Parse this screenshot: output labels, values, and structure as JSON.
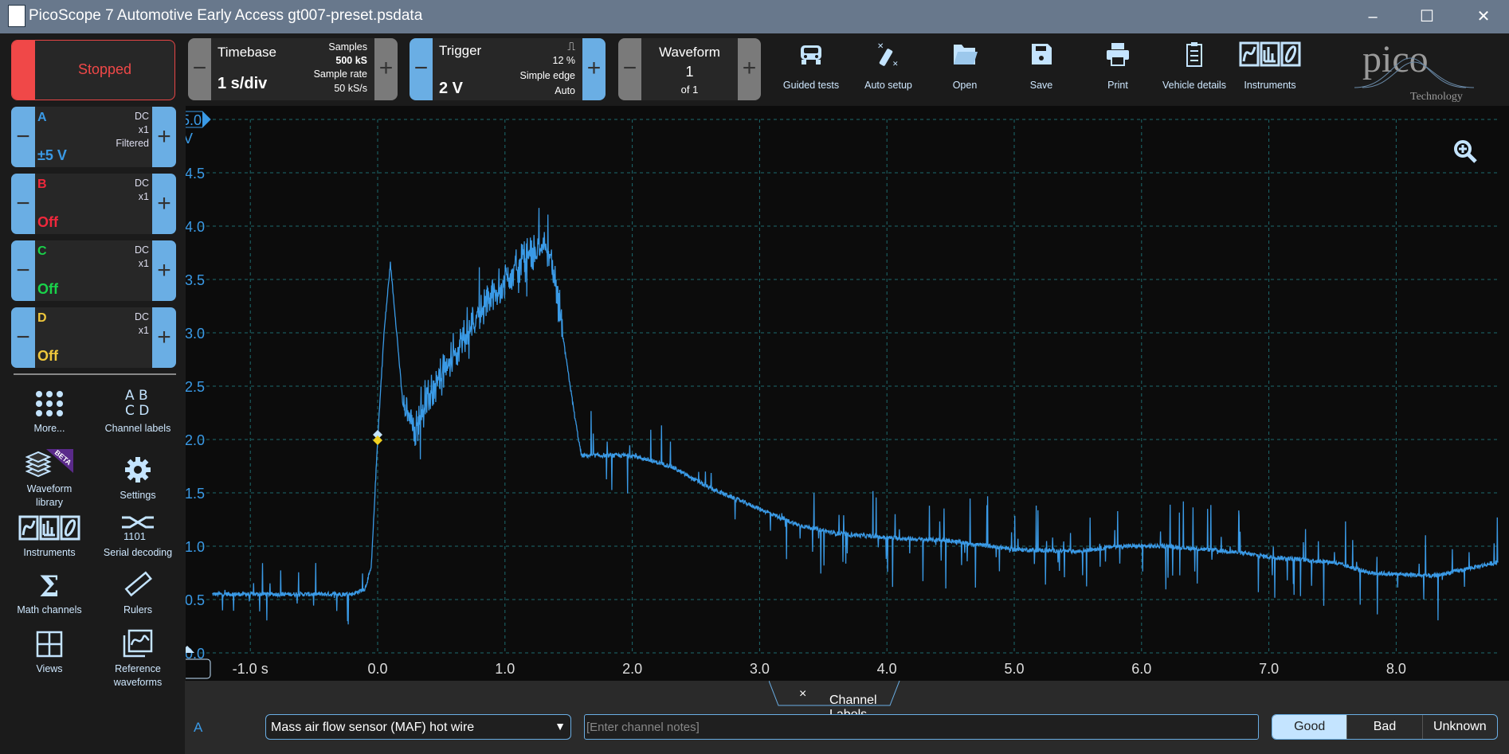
{
  "window": {
    "title": "PicoScope 7 Automotive Early Access gt007-preset.psdata",
    "controls": [
      "minimize",
      "maximize",
      "close"
    ]
  },
  "toolbar": {
    "run_state": "Stopped",
    "timebase": {
      "label": "Timebase",
      "value": "1 s/div",
      "samples_label": "Samples",
      "samples": "500 kS",
      "rate_label": "Sample rate",
      "rate": "50 kS/s"
    },
    "trigger": {
      "label": "Trigger",
      "value": "2 V",
      "pre": "12 %",
      "type": "Simple edge",
      "mode": "Auto",
      "edge_icon": "rising-edge-icon"
    },
    "waveform": {
      "label": "Waveform",
      "value": "1",
      "of": "of 1"
    },
    "tools": [
      {
        "label": "Guided tests",
        "icon": "car-icon"
      },
      {
        "label": "Auto setup",
        "icon": "magic-wand-icon"
      },
      {
        "label": "Open",
        "icon": "folder-open-icon"
      },
      {
        "label": "Save",
        "icon": "save-icon"
      },
      {
        "label": "Print",
        "icon": "printer-icon"
      },
      {
        "label": "Vehicle details",
        "icon": "clipboard-icon"
      },
      {
        "label": "Instruments",
        "icon": "instruments-icon"
      }
    ],
    "logo": {
      "text": "pico",
      "sub": "Technology"
    }
  },
  "channels": [
    {
      "name": "A",
      "value": "±5 V",
      "coupling": "DC",
      "probe": "x1",
      "filter": "Filtered",
      "color": "#3a9ae6"
    },
    {
      "name": "B",
      "value": "Off",
      "coupling": "DC",
      "probe": "x1",
      "color": "#f0283c"
    },
    {
      "name": "C",
      "value": "Off",
      "coupling": "DC",
      "probe": "x1",
      "color": "#19d24a"
    },
    {
      "name": "D",
      "value": "Off",
      "coupling": "DC",
      "probe": "x1",
      "color": "#f0c83c"
    }
  ],
  "left_tools": [
    {
      "label": "More...",
      "icon": "more-dots-icon"
    },
    {
      "label": "Channel labels",
      "icon": "channel-labels-icon"
    },
    {
      "label": "Waveform library",
      "icon": "waveform-library-icon",
      "badge": "BETA"
    },
    {
      "label": "Settings",
      "icon": "gear-icon"
    },
    {
      "label": "Instruments",
      "icon": "instruments-icon"
    },
    {
      "label": "Serial decoding",
      "icon": "serial-decoding-icon"
    },
    {
      "label": "Math channels",
      "icon": "sigma-icon"
    },
    {
      "label": "Rulers",
      "icon": "ruler-icon"
    },
    {
      "label": "Views",
      "icon": "views-grid-icon"
    },
    {
      "label": "Reference waveforms",
      "icon": "reference-waveforms-icon"
    }
  ],
  "chart_data": {
    "type": "line",
    "x_unit": "s",
    "y_unit": "V",
    "xlim": [
      -1.3,
      8.8
    ],
    "ylim": [
      0,
      5
    ],
    "x_ticks": [
      "-1.0 s",
      "0.0",
      "1.0",
      "2.0",
      "3.0",
      "4.0",
      "5.0",
      "6.0",
      "7.0",
      "8.0"
    ],
    "y_ticks": [
      "0.0",
      "0.5",
      "1.0",
      "1.5",
      "2.0",
      "2.5",
      "3.0",
      "3.5",
      "4.0",
      "4.5",
      "5.0"
    ],
    "y_top_label": "5.0",
    "y_unit_label": "V",
    "grid": true,
    "trigger_point": {
      "t": 0,
      "v": 2.0
    },
    "series": [
      {
        "channel": "A",
        "color": "#3a9ae6",
        "points": [
          [
            -1.3,
            0.55
          ],
          [
            -0.2,
            0.55
          ],
          [
            -0.1,
            0.6
          ],
          [
            -0.05,
            0.8
          ],
          [
            0,
            2.0
          ],
          [
            0.05,
            3.0
          ],
          [
            0.1,
            3.65
          ],
          [
            0.15,
            3.0
          ],
          [
            0.2,
            2.3
          ],
          [
            0.3,
            2.1
          ],
          [
            0.4,
            2.4
          ],
          [
            0.6,
            2.8
          ],
          [
            0.8,
            3.2
          ],
          [
            1.0,
            3.5
          ],
          [
            1.2,
            3.75
          ],
          [
            1.35,
            3.8
          ],
          [
            1.45,
            3.0
          ],
          [
            1.55,
            2.2
          ],
          [
            1.6,
            1.85
          ],
          [
            2.0,
            1.85
          ],
          [
            2.3,
            1.75
          ],
          [
            2.6,
            1.55
          ],
          [
            3.0,
            1.35
          ],
          [
            3.3,
            1.2
          ],
          [
            3.6,
            1.12
          ],
          [
            4.0,
            1.08
          ],
          [
            4.5,
            1.05
          ],
          [
            5.0,
            0.97
          ],
          [
            5.5,
            0.95
          ],
          [
            5.8,
            1.0
          ],
          [
            6.2,
            1.0
          ],
          [
            6.7,
            0.95
          ],
          [
            7.0,
            0.9
          ],
          [
            7.5,
            0.85
          ],
          [
            7.8,
            0.75
          ],
          [
            8.3,
            0.72
          ],
          [
            8.6,
            0.8
          ],
          [
            8.8,
            0.85
          ]
        ]
      }
    ]
  },
  "channel_labels": {
    "tab": "Channel Labels",
    "close": "×",
    "channel": "A",
    "selected_label": "Mass air flow sensor (MAF) hot wire",
    "notes_placeholder": "[Enter channel notes]",
    "ratings": [
      "Good",
      "Bad",
      "Unknown"
    ],
    "selected_rating": "Good"
  }
}
